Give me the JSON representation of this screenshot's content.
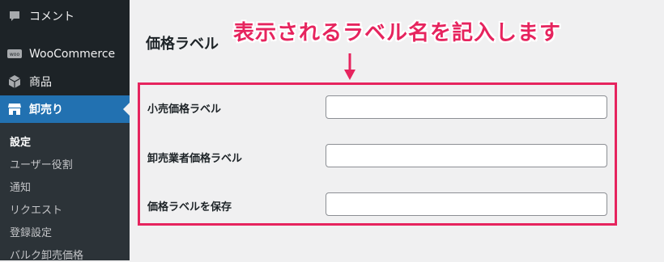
{
  "sidebar": {
    "items": [
      {
        "label": "コメント",
        "icon": "comment-icon"
      },
      {
        "label": "WooCommerce",
        "icon": "woo-icon"
      },
      {
        "label": "商品",
        "icon": "box-icon"
      },
      {
        "label": "卸売り",
        "icon": "store-icon"
      }
    ],
    "submenu": [
      "設定",
      "ユーザー役割",
      "通知",
      "リクエスト",
      "登録設定",
      "バルク卸売価格"
    ]
  },
  "main": {
    "heading": "価格ラベル",
    "callout": "表示されるラベル名を記入します",
    "fields": [
      {
        "label": "小売価格ラベル",
        "value": ""
      },
      {
        "label": "卸売業者価格ラベル",
        "value": ""
      },
      {
        "label": "価格ラベルを保存",
        "value": ""
      }
    ]
  },
  "colors": {
    "accent": "#e6245e",
    "sidebar_bg": "#1d2327",
    "active_bg": "#2271b1"
  }
}
